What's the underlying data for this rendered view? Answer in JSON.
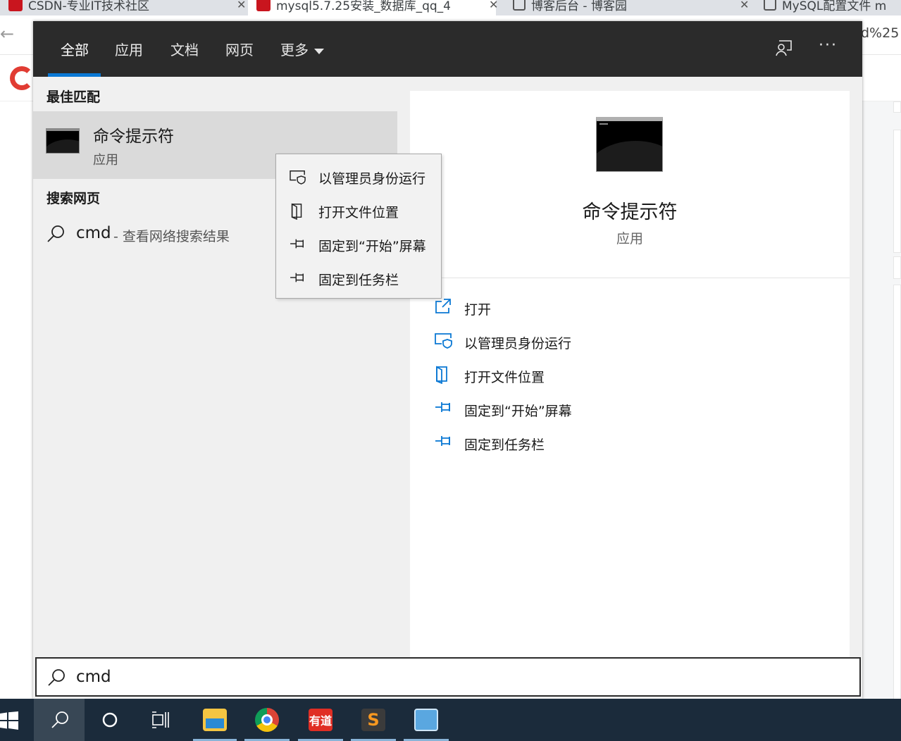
{
  "browser": {
    "tabs": [
      {
        "title": "CSDN-专业IT技术社区"
      },
      {
        "title": "mysql5.7.25安装_数据库_qq_4"
      },
      {
        "title": "博客后台 - 博客园"
      },
      {
        "title": "MySQL配置文件 m"
      }
    ],
    "address_fragment": "d%25"
  },
  "search_panel": {
    "tabs": [
      {
        "label": "全部"
      },
      {
        "label": "应用"
      },
      {
        "label": "文档"
      },
      {
        "label": "网页"
      },
      {
        "label": "更多"
      }
    ],
    "active_tab": "全部",
    "best_match": {
      "section_title": "最佳匹配",
      "name": "命令提示符",
      "type": "应用"
    },
    "web": {
      "section_title": "搜索网页",
      "query": "cmd",
      "hint": "- 查看网络搜索结果"
    },
    "preview": {
      "name": "命令提示符",
      "type": "应用",
      "actions": [
        {
          "label": "打开",
          "icon": "open-external-icon"
        },
        {
          "label": "以管理员身份运行",
          "icon": "admin-shield-icon"
        },
        {
          "label": "打开文件位置",
          "icon": "file-location-icon"
        },
        {
          "label": "固定到“开始”屏幕",
          "icon": "pin-icon"
        },
        {
          "label": "固定到任务栏",
          "icon": "pin-icon"
        }
      ],
      "accent_color": "#0a78d4"
    },
    "context_menu": [
      {
        "label": "以管理员身份运行",
        "icon": "admin-shield-icon"
      },
      {
        "label": "打开文件位置",
        "icon": "file-location-icon"
      },
      {
        "label": "固定到“开始”屏幕",
        "icon": "pin-icon"
      },
      {
        "label": "固定到任务栏",
        "icon": "pin-icon"
      }
    ],
    "search_box": {
      "value": "cmd"
    }
  },
  "taskbar": {
    "items": [
      {
        "name": "windows-start-icon"
      },
      {
        "name": "search-icon",
        "active": true
      },
      {
        "name": "cortana-icon"
      },
      {
        "name": "task-view-icon"
      },
      {
        "name": "file-explorer-icon",
        "running": true
      },
      {
        "name": "chrome-icon",
        "running": true
      },
      {
        "name": "youdao-icon",
        "label": "有道",
        "running": true
      },
      {
        "name": "sublime-text-icon",
        "running": true
      },
      {
        "name": "control-panel-icon",
        "running": true
      }
    ]
  }
}
